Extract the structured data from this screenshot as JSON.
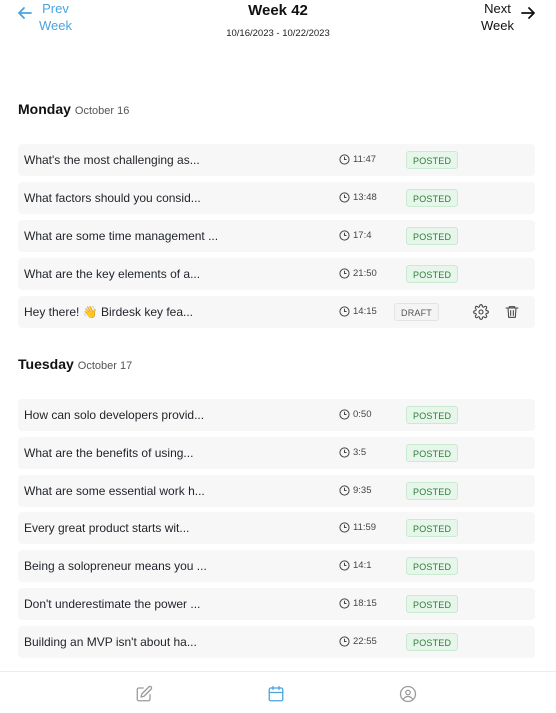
{
  "header": {
    "prev_line1": "Prev",
    "prev_line2": "Week",
    "next_line1": "Next",
    "next_line2": "Week",
    "title": "Week 42",
    "range": "10/16/2023 - 10/22/2023"
  },
  "days": [
    {
      "name": "Monday",
      "date": "October 16",
      "posts": [
        {
          "text": "What's the most challenging as...",
          "time": "11:47",
          "status": "POSTED"
        },
        {
          "text": "What factors should you consid...",
          "time": "13:48",
          "status": "POSTED"
        },
        {
          "text": "What are some time management ...",
          "time": "17:4",
          "status": "POSTED"
        },
        {
          "text": "What are the key elements of a...",
          "time": "21:50",
          "status": "POSTED"
        },
        {
          "text": "Hey there! 👋 Birdesk key fea...",
          "time": "14:15",
          "status": "DRAFT"
        }
      ]
    },
    {
      "name": "Tuesday",
      "date": "October 17",
      "posts": [
        {
          "text": "How can solo developers provid...",
          "time": "0:50",
          "status": "POSTED"
        },
        {
          "text": "What are the benefits of using...",
          "time": "3:5",
          "status": "POSTED"
        },
        {
          "text": "What are some essential work h...",
          "time": "9:35",
          "status": "POSTED"
        },
        {
          "text": "Every great product starts wit...",
          "time": "11:59",
          "status": "POSTED"
        },
        {
          "text": "Being a solopreneur means you ...",
          "time": "14:1",
          "status": "POSTED"
        },
        {
          "text": "Don't underestimate the power ...",
          "time": "18:15",
          "status": "POSTED"
        },
        {
          "text": "Building an MVP isn't about ha...",
          "time": "22:55",
          "status": "POSTED"
        }
      ]
    }
  ],
  "colors": {
    "accent": "#4aa3df",
    "posted_bg": "#e7f6ea",
    "posted_text": "#2f7a3b",
    "row_bg": "#f7f7f8"
  },
  "bottom_nav": {
    "items": [
      {
        "icon": "edit-icon",
        "active": false
      },
      {
        "icon": "calendar-icon",
        "active": true
      },
      {
        "icon": "user-circle-icon",
        "active": false
      }
    ]
  }
}
